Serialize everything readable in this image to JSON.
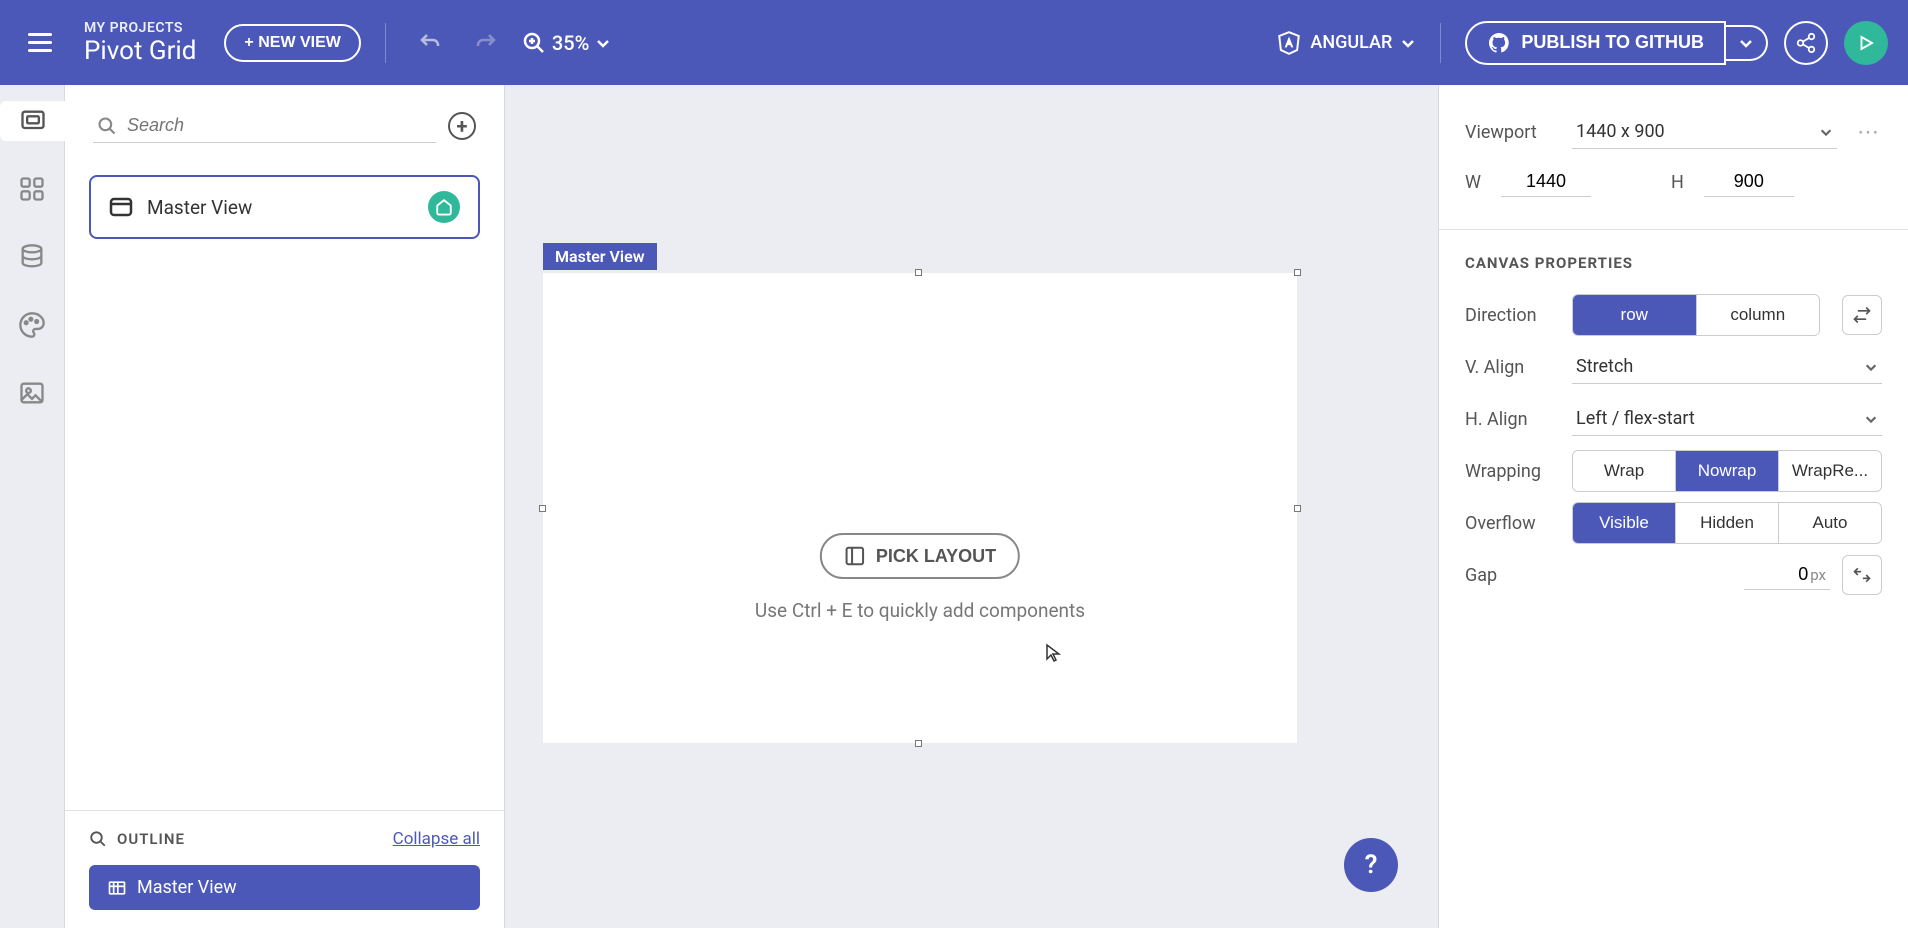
{
  "topbar": {
    "breadcrumb": "MY PROJECTS",
    "projectName": "Pivot Grid",
    "newViewLabel": "+ NEW VIEW",
    "zoomLevel": "35%",
    "framework": "ANGULAR",
    "publishLabel": "PUBLISH TO GITHUB"
  },
  "leftPanel": {
    "searchPlaceholder": "Search",
    "viewCard": "Master View",
    "outlineTitle": "OUTLINE",
    "collapseLabel": "Collapse all",
    "outlineItem": "Master View"
  },
  "canvas": {
    "viewLabel": "Master View",
    "pickLayoutLabel": "PICK LAYOUT",
    "hint": "Use Ctrl + E to quickly add components",
    "helpSymbol": "?"
  },
  "rightPanel": {
    "viewportLabel": "Viewport",
    "viewportValue": "1440 x 900",
    "wLabel": "W",
    "wValue": "1440",
    "hLabel": "H",
    "hValue": "900",
    "sectionTitle": "CANVAS PROPERTIES",
    "directionLabel": "Direction",
    "directionOptions": {
      "row": "row",
      "column": "column"
    },
    "vAlignLabel": "V. Align",
    "vAlignValue": "Stretch",
    "hAlignLabel": "H. Align",
    "hAlignValue": "Left / flex-start",
    "wrappingLabel": "Wrapping",
    "wrappingOptions": {
      "wrap": "Wrap",
      "nowrap": "Nowrap",
      "wrapRev": "WrapRe..."
    },
    "overflowLabel": "Overflow",
    "overflowOptions": {
      "visible": "Visible",
      "hidden": "Hidden",
      "auto": "Auto"
    },
    "gapLabel": "Gap",
    "gapValue": "0",
    "gapUnit": "px"
  }
}
